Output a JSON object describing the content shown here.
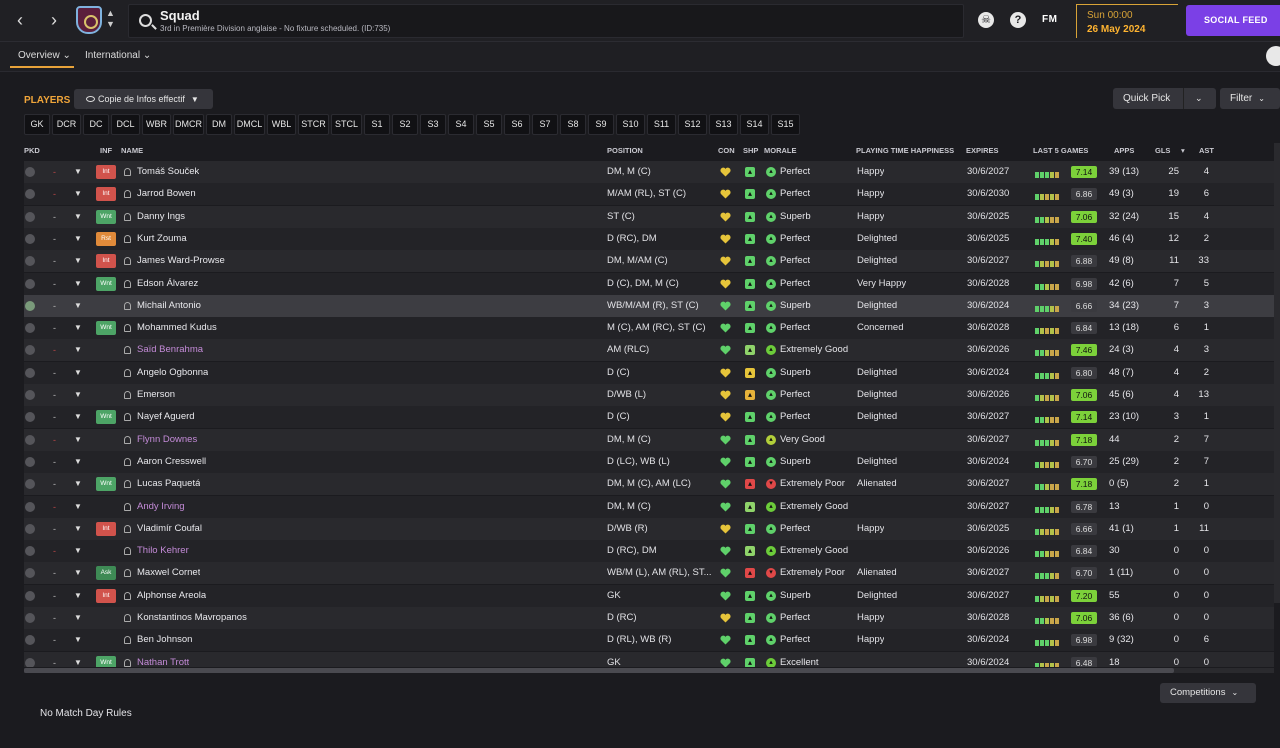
{
  "header": {
    "title": "Squad",
    "subtitle": "3rd in Première Division anglaise - No fixture scheduled. (ID:735)",
    "fm_logo": "FM",
    "date_day": "Sun 00:00",
    "date": "26 May 2024",
    "social_button": "SOCIAL FEED",
    "help_icon": "?"
  },
  "tabs": [
    {
      "label": "Overview ⌄"
    },
    {
      "label": "International ⌄"
    }
  ],
  "players": {
    "label": "PLAYERS",
    "view": "Copie de Infos effectif",
    "quick_pick": "Quick Pick",
    "filter": "Filter"
  },
  "positions": [
    "GK",
    "DCR",
    "DC",
    "DCL",
    "WBR",
    "DMCR",
    "DM",
    "DMCL",
    "WBL",
    "STCR",
    "STCL",
    "S1",
    "S2",
    "S3",
    "S4",
    "S5",
    "S6",
    "S7",
    "S8",
    "S9",
    "S10",
    "S11",
    "S12",
    "S13",
    "S14",
    "S15"
  ],
  "columns": {
    "pkd": "PKD",
    "inf": "INF",
    "name": "NAME",
    "position": "POSITION",
    "con": "CON",
    "shp": "SHP",
    "morale": "MORALE",
    "happiness": "PLAYING TIME HAPPINESS",
    "expires": "EXPIRES",
    "last5": "LAST 5 GAMES",
    "apps": "APPS",
    "gls": "GLS",
    "ast": "AST"
  },
  "rows": [
    {
      "name": "Tomáš Souček",
      "inf": "Int",
      "pos": "DM, M (C)",
      "morale": "Perfect",
      "happy": "Happy",
      "exp": "30/6/2027",
      "rating": "7.14",
      "apps": "39 (13)",
      "gls": "25",
      "ast": "4"
    },
    {
      "name": "Jarrod Bowen",
      "inf": "Int",
      "pos": "M/AM (RL), ST (C)",
      "morale": "Perfect",
      "happy": "Happy",
      "exp": "30/6/2030",
      "rating": "6.86",
      "apps": "49 (3)",
      "gls": "19",
      "ast": "6"
    },
    {
      "name": "Danny Ings",
      "inf": "Wnt",
      "pos": "ST (C)",
      "morale": "Superb",
      "happy": "Happy",
      "exp": "30/6/2025",
      "rating": "7.06",
      "apps": "32 (24)",
      "gls": "15",
      "ast": "4"
    },
    {
      "name": "Kurt Zouma",
      "inf": "Rst",
      "pos": "D (RC), DM",
      "morale": "Perfect",
      "happy": "Delighted",
      "exp": "30/6/2025",
      "rating": "7.40",
      "apps": "46 (4)",
      "gls": "12",
      "ast": "2"
    },
    {
      "name": "James Ward-Prowse",
      "inf": "Int",
      "pos": "DM, M/AM (C)",
      "morale": "Perfect",
      "happy": "Delighted",
      "exp": "30/6/2027",
      "rating": "6.88",
      "apps": "49 (8)",
      "gls": "11",
      "ast": "33"
    },
    {
      "name": "Edson Álvarez",
      "inf": "Wnt",
      "pos": "D (C), DM, M (C)",
      "morale": "Perfect",
      "happy": "Very Happy",
      "exp": "30/6/2028",
      "rating": "6.98",
      "apps": "42 (6)",
      "gls": "7",
      "ast": "5"
    },
    {
      "name": "Michail Antonio",
      "inf": "",
      "pos": "WB/M/AM (R), ST (C)",
      "morale": "Superb",
      "happy": "Delighted",
      "exp": "30/6/2024",
      "rating": "6.66",
      "apps": "34 (23)",
      "gls": "7",
      "ast": "3"
    },
    {
      "name": "Mohammed Kudus",
      "inf": "Wnt",
      "pos": "M (C), AM (RC), ST (C)",
      "morale": "Perfect",
      "happy": "Concerned",
      "exp": "30/6/2028",
      "rating": "6.84",
      "apps": "13 (18)",
      "gls": "6",
      "ast": "1"
    },
    {
      "name": "Saïd Benrahma",
      "inf": "",
      "pos": "AM (RLC)",
      "morale": "Extremely Good",
      "happy": "",
      "exp": "30/6/2026",
      "rating": "7.46",
      "apps": "24 (3)",
      "gls": "4",
      "ast": "3"
    },
    {
      "name": "Angelo Ogbonna",
      "inf": "",
      "pos": "D (C)",
      "morale": "Superb",
      "happy": "Delighted",
      "exp": "30/6/2024",
      "rating": "6.80",
      "apps": "48 (7)",
      "gls": "4",
      "ast": "2"
    },
    {
      "name": "Emerson",
      "inf": "",
      "pos": "D/WB (L)",
      "morale": "Perfect",
      "happy": "Delighted",
      "exp": "30/6/2026",
      "rating": "7.06",
      "apps": "45 (6)",
      "gls": "4",
      "ast": "13"
    },
    {
      "name": "Nayef Aguerd",
      "inf": "Wnt",
      "pos": "D (C)",
      "morale": "Perfect",
      "happy": "Delighted",
      "exp": "30/6/2027",
      "rating": "7.14",
      "apps": "23 (10)",
      "gls": "3",
      "ast": "1"
    },
    {
      "name": "Flynn Downes",
      "inf": "",
      "pos": "DM, M (C)",
      "morale": "Very Good",
      "happy": "",
      "exp": "30/6/2027",
      "rating": "7.18",
      "apps": "44",
      "gls": "2",
      "ast": "7"
    },
    {
      "name": "Aaron Cresswell",
      "inf": "",
      "pos": "D (LC), WB (L)",
      "morale": "Superb",
      "happy": "Delighted",
      "exp": "30/6/2024",
      "rating": "6.70",
      "apps": "25 (29)",
      "gls": "2",
      "ast": "7"
    },
    {
      "name": "Lucas Paquetá",
      "inf": "Wnt",
      "pos": "DM, M (C), AM (LC)",
      "morale": "Extremely Poor",
      "happy": "Alienated",
      "exp": "30/6/2027",
      "rating": "7.18",
      "apps": "0 (5)",
      "gls": "2",
      "ast": "1"
    },
    {
      "name": "Andy Irving",
      "inf": "",
      "pos": "DM, M (C)",
      "morale": "Extremely Good",
      "happy": "",
      "exp": "30/6/2027",
      "rating": "6.78",
      "apps": "13",
      "gls": "1",
      "ast": "0"
    },
    {
      "name": "Vladimír Coufal",
      "inf": "Int",
      "pos": "D/WB (R)",
      "morale": "Perfect",
      "happy": "Happy",
      "exp": "30/6/2025",
      "rating": "6.66",
      "apps": "41 (1)",
      "gls": "1",
      "ast": "11"
    },
    {
      "name": "Thilo Kehrer",
      "inf": "",
      "pos": "D (RC), DM",
      "morale": "Extremely Good",
      "happy": "",
      "exp": "30/6/2026",
      "rating": "6.84",
      "apps": "30",
      "gls": "0",
      "ast": "0"
    },
    {
      "name": "Maxwel Cornet",
      "inf": "Ask",
      "pos": "WB/M (L), AM (RL), ST...",
      "morale": "Extremely Poor",
      "happy": "Alienated",
      "exp": "30/6/2027",
      "rating": "6.70",
      "apps": "1 (11)",
      "gls": "0",
      "ast": "0"
    },
    {
      "name": "Alphonse Areola",
      "inf": "Int",
      "pos": "GK",
      "morale": "Superb",
      "happy": "Delighted",
      "exp": "30/6/2027",
      "rating": "7.20",
      "apps": "55",
      "gls": "0",
      "ast": "0"
    },
    {
      "name": "Konstantinos Mavropanos",
      "inf": "",
      "pos": "D (RC)",
      "morale": "Perfect",
      "happy": "Happy",
      "exp": "30/6/2028",
      "rating": "7.06",
      "apps": "36 (6)",
      "gls": "0",
      "ast": "0"
    },
    {
      "name": "Ben Johnson",
      "inf": "",
      "pos": "D (RL), WB (R)",
      "morale": "Perfect",
      "happy": "Happy",
      "exp": "30/6/2024",
      "rating": "6.98",
      "apps": "9 (32)",
      "gls": "0",
      "ast": "6"
    },
    {
      "name": "Nathan Trott",
      "inf": "Wnt",
      "pos": "GK",
      "morale": "Excellent",
      "happy": "",
      "exp": "30/6/2024",
      "rating": "6.48",
      "apps": "18",
      "gls": "0",
      "ast": "0"
    }
  ],
  "footer": {
    "competitions": "Competitions",
    "match_rules": "No Match Day Rules"
  }
}
